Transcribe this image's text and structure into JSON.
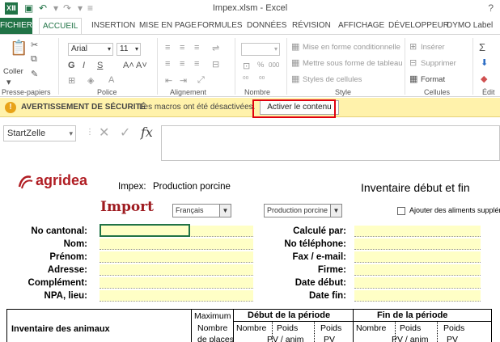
{
  "window": {
    "title": "Impex.xlsm - Excel",
    "logo": "XⅡ",
    "help": "?"
  },
  "tabs": {
    "file": "FICHIER",
    "home": "ACCUEIL",
    "insert": "INSERTION",
    "layout": "MISE EN PAGE",
    "formulas": "FORMULES",
    "data": "DONNÉES",
    "review": "RÉVISION",
    "view": "AFFICHAGE",
    "developer": "DÉVELOPPEUR",
    "dymo": "DYMO Label"
  },
  "ribbon": {
    "paste": "Coller",
    "clipboard": "Presse-papiers",
    "font_name": "Arial",
    "font_size": "11",
    "font": "Police",
    "alignment": "Alignement",
    "number": "Nombre",
    "percent": "%",
    "thousands": "000",
    "cond_format": "Mise en forme conditionnelle",
    "format_table": "Mettre sous forme de tableau",
    "cell_styles": "Styles de cellules",
    "style": "Style",
    "insert": "Insérer",
    "delete": "Supprimer",
    "format": "Format",
    "cells": "Cellules",
    "edit": "Édit"
  },
  "security": {
    "icon": "!",
    "title": "AVERTISSEMENT DE SÉCURITÉ",
    "message": "Les macros ont été désactivées.",
    "button": "Activer le contenu"
  },
  "formula_bar": {
    "name_box": "StartZelle",
    "cancel": "✕",
    "enter": "✓",
    "fx": "fx"
  },
  "sheet": {
    "logo": "agridea",
    "impex_label": "Impex:",
    "impex_value": "Production porcine",
    "title_right": "Inventaire début et fin",
    "import": "Import",
    "language": "Français",
    "production": "Production porcine",
    "add_feed": "Ajouter des aliments supplém.",
    "left_labels": [
      "No cantonal:",
      "Nom:",
      "Prénom:",
      "Adresse:",
      "Complément:",
      "NPA, lieu:"
    ],
    "right_labels": [
      "Calculé par:",
      "No téléphone:",
      "Fax / e-mail:",
      "Firme:",
      "Date début:",
      "Date fin:"
    ]
  },
  "table": {
    "animals": "Inventaire des animaux",
    "maximum": "Maximum",
    "nombre": "Nombre",
    "de_places": "de places",
    "start": "Début de la période",
    "end": "Fin de la période",
    "nombre_col": "Nombre",
    "poids": "Poids",
    "pv_anim": "PV / anim",
    "pv": "PV"
  }
}
